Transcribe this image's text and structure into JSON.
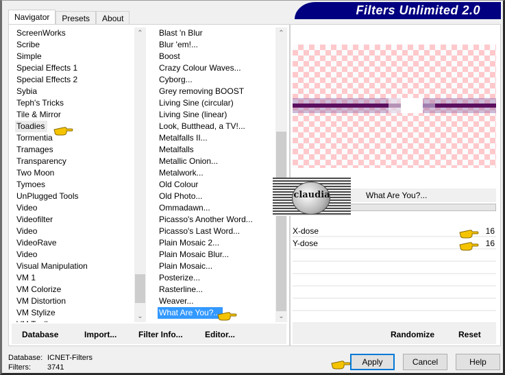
{
  "tabs": [
    {
      "label": "Navigator",
      "active": true
    },
    {
      "label": "Presets",
      "active": false
    },
    {
      "label": "About",
      "active": false
    }
  ],
  "title": "Filters Unlimited 2.0",
  "categories": [
    {
      "label": "ScreenWorks"
    },
    {
      "label": "Scribe"
    },
    {
      "label": "Simple"
    },
    {
      "label": "Special Effects 1"
    },
    {
      "label": "Special Effects 2"
    },
    {
      "label": "Sybia"
    },
    {
      "label": "Teph's Tricks"
    },
    {
      "label": "Tile & Mirror"
    },
    {
      "label": "Toadies",
      "state": "hover"
    },
    {
      "label": "Tormentia"
    },
    {
      "label": "Tramages"
    },
    {
      "label": "Transparency"
    },
    {
      "label": "Two Moon"
    },
    {
      "label": "Tymoes"
    },
    {
      "label": "UnPlugged Tools"
    },
    {
      "label": "Video"
    },
    {
      "label": "Videofilter"
    },
    {
      "label": "Video"
    },
    {
      "label": "VideoRave"
    },
    {
      "label": "Video"
    },
    {
      "label": "Visual Manipulation"
    },
    {
      "label": "VM 1"
    },
    {
      "label": "VM Colorize"
    },
    {
      "label": "VM Distortion"
    },
    {
      "label": "VM Stylize"
    },
    {
      "label": "VM Toolbox"
    }
  ],
  "filters": [
    {
      "label": "Blast 'n Blur"
    },
    {
      "label": "Blur 'em!..."
    },
    {
      "label": "Boost"
    },
    {
      "label": "Crazy Colour Waves..."
    },
    {
      "label": "Cyborg..."
    },
    {
      "label": "Grey removing BOOST"
    },
    {
      "label": "Living Sine (circular)"
    },
    {
      "label": "Living Sine (linear)"
    },
    {
      "label": "Look, Butthead, a TV!..."
    },
    {
      "label": "Metalfalls II..."
    },
    {
      "label": "Metalfalls"
    },
    {
      "label": "Metallic Onion..."
    },
    {
      "label": "Metalwork..."
    },
    {
      "label": "Old Colour"
    },
    {
      "label": "Old Photo..."
    },
    {
      "label": "Ommadawn..."
    },
    {
      "label": "Picasso's Another Word..."
    },
    {
      "label": "Picasso's Last Word..."
    },
    {
      "label": "Plain Mosaic 2..."
    },
    {
      "label": "Plain Mosaic Blur..."
    },
    {
      "label": "Plain Mosaic..."
    },
    {
      "label": "Posterize..."
    },
    {
      "label": "Rasterline..."
    },
    {
      "label": "Weaver..."
    },
    {
      "label": "What Are You?...",
      "state": "selected"
    }
  ],
  "nav_buttons": {
    "database": "Database",
    "import": "Import...",
    "filter_info": "Filter Info...",
    "editor": "Editor..."
  },
  "preview": {
    "filter_name": "What Are You?...",
    "watermark": "claudia"
  },
  "params": [
    {
      "label": "X-dose",
      "value": "16"
    },
    {
      "label": "Y-dose",
      "value": "16"
    }
  ],
  "preview_buttons": {
    "randomize": "Randomize",
    "reset": "Reset"
  },
  "status": {
    "database_label": "Database:",
    "database_value": "ICNET-Filters",
    "filters_label": "Filters:",
    "filters_value": "3741"
  },
  "dialog_buttons": {
    "apply": "Apply",
    "cancel": "Cancel",
    "help": "Help"
  },
  "colors": {
    "title_banner": "#000080",
    "selection": "#3399ff",
    "preview_stripe": "#5b0f5e",
    "checker_pink": "#ffc9cc"
  }
}
